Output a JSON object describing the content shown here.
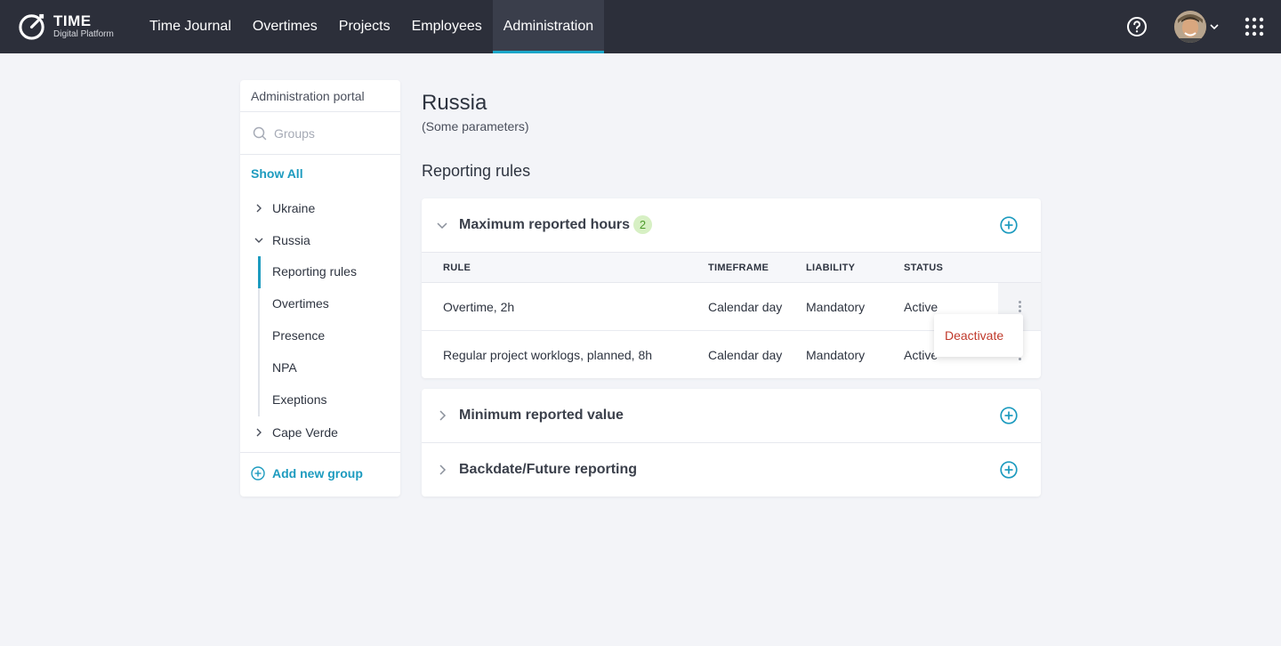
{
  "app": {
    "title": "TIME",
    "subtitle": "Digital Platform"
  },
  "nav": {
    "items": [
      {
        "label": "Time Journal"
      },
      {
        "label": "Overtimes"
      },
      {
        "label": "Projects"
      },
      {
        "label": "Employees"
      },
      {
        "label": "Administration"
      }
    ],
    "active": "Administration",
    "accent": "#1ba6c9"
  },
  "sidebar": {
    "title": "Administration portal",
    "search_placeholder": "Groups",
    "show_all": "Show All",
    "groups": [
      {
        "label": "Ukraine",
        "expanded": false
      },
      {
        "label": "Russia",
        "expanded": true
      },
      {
        "label": "Cape Verde",
        "expanded": false
      }
    ],
    "russia_children": [
      {
        "label": "Reporting rules",
        "active": true
      },
      {
        "label": "Overtimes"
      },
      {
        "label": "Presence"
      },
      {
        "label": "NPA"
      },
      {
        "label": "Exeptions"
      }
    ],
    "add_group": "Add new group"
  },
  "main": {
    "title": "Russia",
    "subtitle": "(Some parameters)",
    "section_title": "Reporting rules",
    "accordions": [
      {
        "title": "Maximum reported hours",
        "badge": "2",
        "expanded": true,
        "columns": [
          "RULE",
          "TIMEFRAME",
          "LIABILITY",
          "STATUS"
        ],
        "rows": [
          {
            "rule": "Overtime, 2h",
            "timeframe": "Calendar day",
            "liability": "Mandatory",
            "status": "Active"
          },
          {
            "rule": "Regular project worklogs, planned, 8h",
            "timeframe": "Calendar day",
            "liability": "Mandatory",
            "status": "Active"
          }
        ]
      },
      {
        "title": "Minimum reported value",
        "expanded": false
      },
      {
        "title": "Backdate/Future reporting",
        "expanded": false
      }
    ],
    "row_menu": {
      "items": [
        "Deactivate"
      ],
      "danger_color": "#c0392b"
    }
  }
}
